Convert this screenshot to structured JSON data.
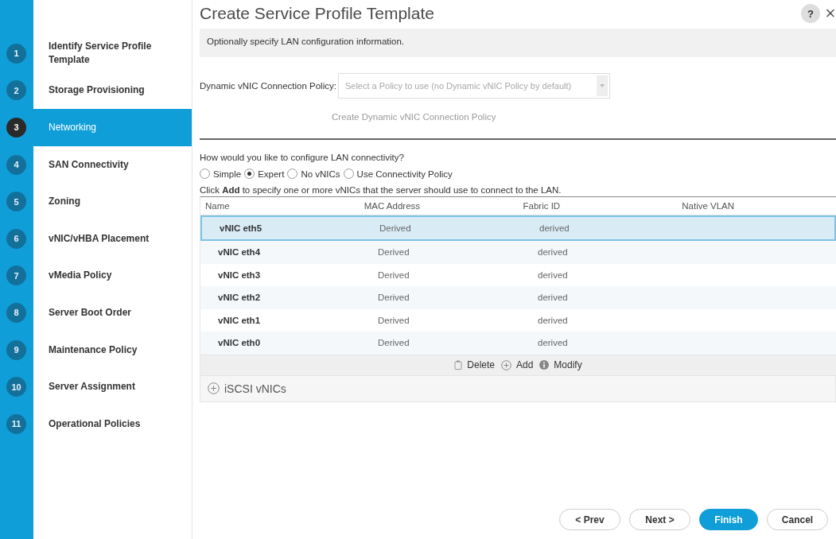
{
  "wizard": {
    "title": "Create Service Profile Template",
    "help": "?",
    "close": "×"
  },
  "steps": [
    {
      "number": "1",
      "label": "Identify Service Profile Template",
      "selected": false
    },
    {
      "number": "2",
      "label": "Storage Provisioning",
      "selected": false
    },
    {
      "number": "3",
      "label": "Networking",
      "selected": true
    },
    {
      "number": "4",
      "label": "SAN Connectivity",
      "selected": false
    },
    {
      "number": "5",
      "label": "Zoning",
      "selected": false
    },
    {
      "number": "6",
      "label": "vNIC/vHBA Placement",
      "selected": false
    },
    {
      "number": "7",
      "label": "vMedia Policy",
      "selected": false
    },
    {
      "number": "8",
      "label": "Server Boot Order",
      "selected": false
    },
    {
      "number": "9",
      "label": "Maintenance Policy",
      "selected": false
    },
    {
      "number": "10",
      "label": "Server Assignment",
      "selected": false
    },
    {
      "number": "11",
      "label": "Operational Policies",
      "selected": false
    }
  ],
  "info": "Optionally specify LAN configuration information.",
  "dynamic_policy": {
    "label": "Dynamic vNIC Connection Policy:",
    "placeholder": "Select a Policy to use (no Dynamic vNIC Policy by default)",
    "disabled": true,
    "create_link": "Create Dynamic vNIC Connection Policy"
  },
  "question": "How would you like to configure LAN connectivity?",
  "options": [
    {
      "label": "Simple",
      "selected": false
    },
    {
      "label": "Expert",
      "selected": true
    },
    {
      "label": "No vNICs",
      "selected": false
    },
    {
      "label": "Use Connectivity Policy",
      "selected": false
    }
  ],
  "hint": "Click **Add** to specify one or more vNICs that the server should use to connect to the LAN.",
  "table": {
    "columns": [
      "Name",
      "MAC Address",
      "Fabric ID",
      "Native VLAN"
    ],
    "rows": [
      {
        "cells": [
          "vNIC eth5",
          "Derived",
          "derived"
        ],
        "selected": true
      },
      {
        "cells": [
          "vNIC eth4",
          "Derived",
          "derived"
        ],
        "selected": false
      },
      {
        "cells": [
          "vNIC eth3",
          "Derived",
          "derived"
        ],
        "selected": false
      },
      {
        "cells": [
          "vNIC eth2",
          "Derived",
          "derived"
        ],
        "selected": false
      },
      {
        "cells": [
          "vNIC eth1",
          "Derived",
          "derived"
        ],
        "selected": false
      },
      {
        "cells": [
          "vNIC eth0",
          "Derived",
          "derived"
        ],
        "selected": false
      }
    ]
  },
  "table_actions": [
    "Delete",
    "Add",
    "Modify"
  ],
  "iscsi": {
    "label": "iSCSI vNICs",
    "expanded": false
  },
  "buttons": [
    {
      "label": "< Prev",
      "kind": "plain"
    },
    {
      "label": "Next >",
      "kind": "plain"
    },
    {
      "label": "Finish",
      "kind": "primary"
    },
    {
      "label": "Cancel",
      "kind": "plain"
    }
  ]
}
